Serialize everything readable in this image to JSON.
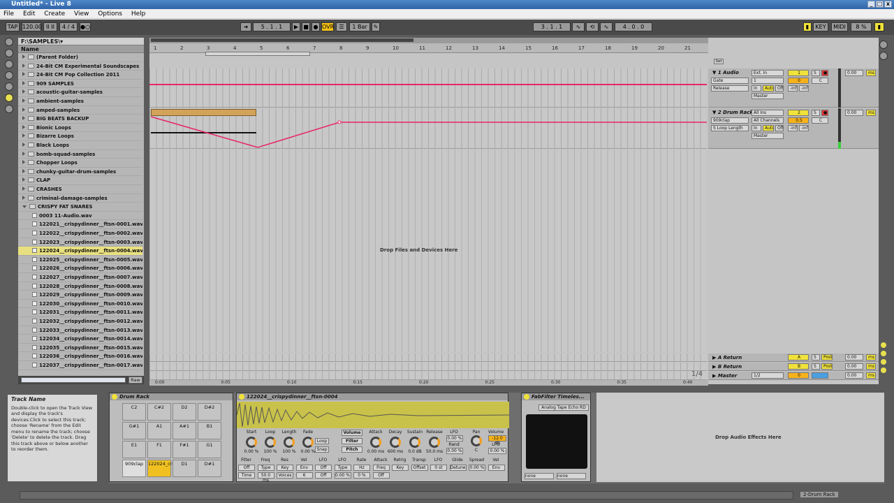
{
  "window": {
    "title": "Untitled* - Live 8",
    "controls": [
      "_",
      "□",
      "x"
    ]
  },
  "menu": [
    "File",
    "Edit",
    "Create",
    "View",
    "Options",
    "Help"
  ],
  "transport": {
    "tap": "TAP",
    "tempo": "120.00",
    "time_sig": "4 / 4",
    "position": "5 . 1 . 1",
    "ovr": "OVR",
    "quantize": "1 Bar",
    "loop_start": "3 . 1 . 1",
    "loop_length": "4 . 0 . 0",
    "key": "KEY",
    "midi": "MIDI",
    "cpu": "8 %"
  },
  "browser": {
    "path": "F:\\SAMPLES\\▾",
    "column_header": "Name",
    "items": [
      {
        "label": "(Parent Folder)",
        "type": "folder",
        "indent": 0
      },
      {
        "label": "24-Bit CM Experimental Soundscapes",
        "type": "folder",
        "indent": 0
      },
      {
        "label": "24-Bit CM Pop Collection 2011",
        "type": "folder",
        "indent": 0
      },
      {
        "label": "909 SAMPLES",
        "type": "folder",
        "indent": 0
      },
      {
        "label": "acoustic-guitar-samples",
        "type": "folder",
        "indent": 0
      },
      {
        "label": "ambient-samples",
        "type": "folder",
        "indent": 0
      },
      {
        "label": "amped-samples",
        "type": "folder",
        "indent": 0
      },
      {
        "label": "BIG BEATS BACKUP",
        "type": "folder",
        "indent": 0
      },
      {
        "label": "Bionic Loops",
        "type": "folder",
        "indent": 0
      },
      {
        "label": "Bizarre Loops",
        "type": "folder",
        "indent": 0
      },
      {
        "label": "Black Loops",
        "type": "folder",
        "indent": 0
      },
      {
        "label": "bomb-squad-samples",
        "type": "folder",
        "indent": 0
      },
      {
        "label": "Chopper Loops",
        "type": "folder",
        "indent": 0
      },
      {
        "label": "chunky-guitar-drum-samples",
        "type": "folder",
        "indent": 0
      },
      {
        "label": "CLAP",
        "type": "folder",
        "indent": 0
      },
      {
        "label": "CRASHES",
        "type": "folder",
        "indent": 0
      },
      {
        "label": "criminal-damage-samples",
        "type": "folder",
        "indent": 0
      },
      {
        "label": "CRISPY FAT SNARES",
        "type": "folder",
        "indent": 0,
        "open": true
      },
      {
        "label": "0003 11-Audio.wav",
        "type": "file",
        "indent": 1
      },
      {
        "label": "122021__crispydinner__ftsn-0001.wav",
        "type": "file",
        "indent": 1
      },
      {
        "label": "122022__crispydinner__ftsn-0002.wav",
        "type": "file",
        "indent": 1
      },
      {
        "label": "122023__crispydinner__ftsn-0003.wav",
        "type": "file",
        "indent": 1
      },
      {
        "label": "122024__crispydinner__ftsn-0004.wav",
        "type": "file",
        "indent": 1,
        "selected": true
      },
      {
        "label": "122025__crispydinner__ftsn-0005.wav",
        "type": "file",
        "indent": 1
      },
      {
        "label": "122026__crispydinner__ftsn-0006.wav",
        "type": "file",
        "indent": 1
      },
      {
        "label": "122027__crispydinner__ftsn-0007.wav",
        "type": "file",
        "indent": 1
      },
      {
        "label": "122028__crispydinner__ftsn-0008.wav",
        "type": "file",
        "indent": 1
      },
      {
        "label": "122029__crispydinner__ftsn-0009.wav",
        "type": "file",
        "indent": 1
      },
      {
        "label": "122030__crispydinner__ftsn-0010.wav",
        "type": "file",
        "indent": 1
      },
      {
        "label": "122031__crispydinner__ftsn-0011.wav",
        "type": "file",
        "indent": 1
      },
      {
        "label": "122032__crispydinner__ftsn-0012.wav",
        "type": "file",
        "indent": 1
      },
      {
        "label": "122033__crispydinner__ftsn-0013.wav",
        "type": "file",
        "indent": 1
      },
      {
        "label": "122034__crispydinner__ftsn-0014.wav",
        "type": "file",
        "indent": 1
      },
      {
        "label": "122035__crispydinner__ftsn-0015.wav",
        "type": "file",
        "indent": 1
      },
      {
        "label": "122036__crispydinner__ftsn-0016.wav",
        "type": "file",
        "indent": 1
      },
      {
        "label": "122037__crispydinner__ftsn-0017.wav",
        "type": "file",
        "indent": 1
      }
    ],
    "raw_button": "Raw"
  },
  "arrangement": {
    "ruler": [
      "1",
      "2",
      "3",
      "4",
      "5",
      "6",
      "7",
      "8",
      "9",
      "10",
      "11",
      "12",
      "13",
      "14",
      "15",
      "16",
      "17",
      "18",
      "19",
      "20",
      "21"
    ],
    "time_ruler": [
      "0:00",
      "0:05",
      "0:10",
      "0:15",
      "0:20",
      "0:25",
      "0:30",
      "0:35",
      "0:40"
    ],
    "zoom_label": "1/4",
    "drop_hint": "Drop Files and Devices Here",
    "set_button": "Set",
    "tracks": [
      {
        "name": "1 Audio",
        "input": "Ext. In",
        "sub_input": "1",
        "monitor": [
          "In",
          "Auto",
          "Off"
        ],
        "output": "Master",
        "number": "1",
        "volume": "-inf",
        "pan": "C",
        "send": "0",
        "automation": [
          "Gate",
          "Release"
        ],
        "meter": "0.00",
        "ms": "ms"
      },
      {
        "name": "2 Drum Rack",
        "input": "All Ins",
        "sub_input": "All Channels",
        "monitor": [
          "In",
          "Auto",
          "Off"
        ],
        "output": "Master",
        "number": "2",
        "volume": "-inf",
        "pan": "C",
        "send": "0.5",
        "automation": [
          "909clap",
          "S Loop Length"
        ],
        "meter": "0.00",
        "ms": "ms"
      }
    ],
    "returns": [
      {
        "name": "A Return",
        "letter": "A",
        "post": "Post",
        "meter": "0.00",
        "ms": "ms"
      },
      {
        "name": "B Return",
        "letter": "B",
        "post": "Post",
        "meter": "0.00",
        "ms": "ms"
      },
      {
        "name": "Master",
        "routing": "1/2",
        "number": "0",
        "meter": "0.00",
        "ms": "ms"
      }
    ]
  },
  "info": {
    "title": "Track Name",
    "body": "Double-click to open the Track View and display the track's devices.Click to select this track; choose 'Rename' from the Edit menu to rename the track; choose 'Delete' to delete the track. Drag this track above or below another to reorder them."
  },
  "devices": {
    "drum_rack": {
      "title": "Drum Rack",
      "pads": [
        [
          "C2",
          "C#2",
          "D2",
          "D#2"
        ],
        [
          "G#1",
          "A1",
          "A#1",
          "B1"
        ],
        [
          "E1",
          "F1",
          "F#1",
          "G1"
        ],
        [
          "909clap",
          "122024_crispydinn",
          "D1",
          "D#1"
        ]
      ],
      "pad_buttons": [
        "M",
        "▶",
        "S"
      ]
    },
    "simpler": {
      "title": "122024__crispydinner__ftsn-0004",
      "knobs_top": [
        {
          "label": "Start",
          "value": "0.00 %"
        },
        {
          "label": "Loop",
          "value": "100 %"
        },
        {
          "label": "Length",
          "value": "100 %"
        },
        {
          "label": "Fade",
          "value": "0.00 %"
        }
      ],
      "loop_btn": "Loop",
      "snap_btn": "Snap",
      "volume_tab": "Volume",
      "filter_tab": "Filter",
      "pitch_tab": "Pitch",
      "env": [
        {
          "label": "Attack",
          "value": "0.00 ms"
        },
        {
          "label": "Decay",
          "value": "600 ms"
        },
        {
          "label": "Sustain",
          "value": "0.0 dB"
        },
        {
          "label": "Release",
          "value": "50.0 ms"
        }
      ],
      "lfo": {
        "label": "LFO",
        "value": "0.00 %",
        "rand": "Rand",
        "rand_value": "0.00 %"
      },
      "pan": {
        "label": "Pan",
        "value": "C"
      },
      "volume": {
        "label": "Volume",
        "value": "-12.0 dB",
        "lfo": "LFO",
        "lfo_value": "0.00 %"
      },
      "bottom": [
        "Filter",
        "Freq",
        "Res",
        "Vel",
        "LFO",
        "LFO",
        "Rate",
        "Attack",
        "Retrig",
        "Transp",
        "LFO",
        "Glide",
        "Spread",
        "Vel"
      ],
      "bottom_values": [
        "Off",
        "Type",
        "Key",
        "Env",
        "Off",
        "Type",
        "Hz",
        "Freq",
        "Key",
        "Offset",
        "0 st",
        "Detune",
        "0.00 %",
        "Env",
        "Time",
        "50.0 ms",
        "Voices",
        "6",
        "Off",
        "0.00 %",
        "0 %",
        "Off"
      ]
    },
    "fabfilter": {
      "title": "FabFilter Timeles...",
      "preset": "Analog Tape Echo RD",
      "slots": [
        "none",
        "none"
      ]
    },
    "drop_audio": "Drop Audio Effects Here"
  },
  "status_bar": {
    "right_label": "2-Drum Rack"
  },
  "colors": {
    "automation": "#e8246a",
    "clip": "#d4a35a",
    "selected_row": "#e8e080",
    "accent_yellow": "#f0e23a"
  }
}
